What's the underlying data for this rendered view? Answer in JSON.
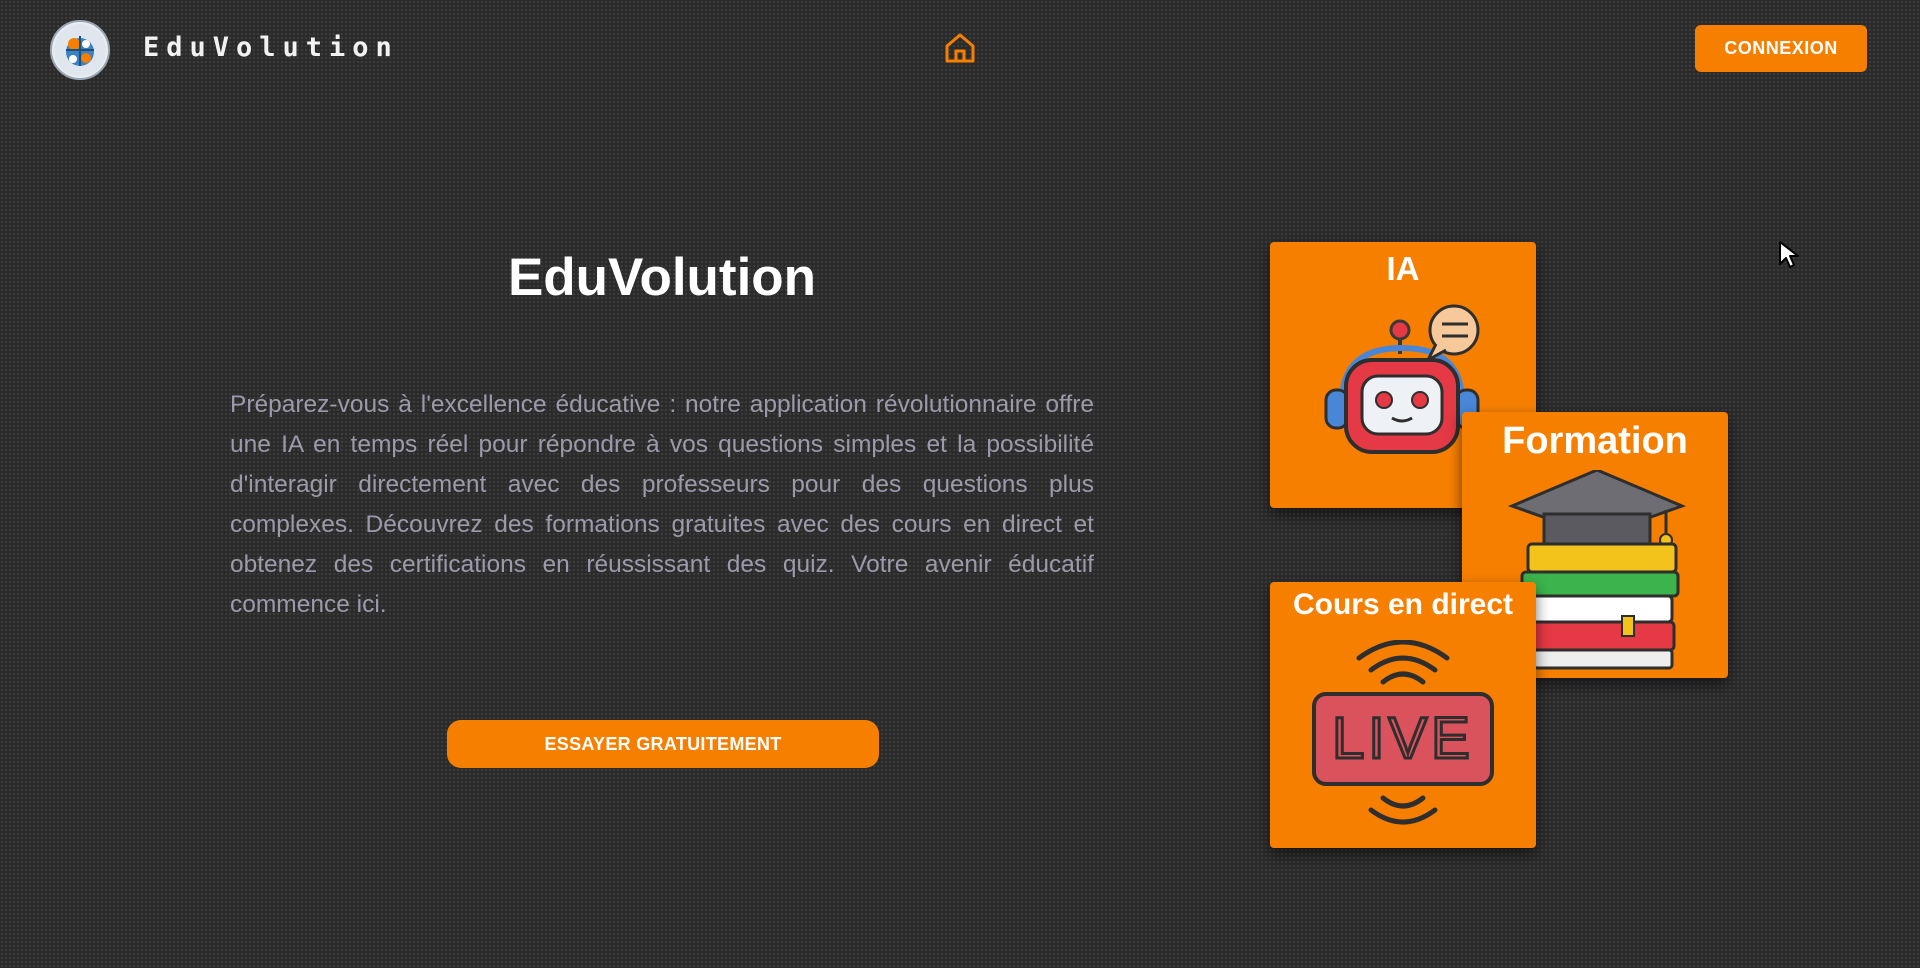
{
  "header": {
    "brand_name": "EduVolution",
    "logo_icon": "eduvolution-logo",
    "home_icon": "home-icon",
    "connexion_label": "CONNEXION"
  },
  "hero": {
    "title": "EduVolution",
    "description": "Préparez-vous à l'excellence éducative : notre application révolutionnaire offre une IA en temps réel pour répondre à vos questions simples et la possibilité d'interagir directement avec des professeurs pour des questions plus complexes. Découvrez des formations gratuites avec des cours en direct et obtenez des certifications en réussissant des quiz. Votre avenir éducatif commence ici.",
    "cta_label": "ESSAYER GRATUITEMENT"
  },
  "cards": [
    {
      "title": "IA",
      "icon": "robot-chat-icon"
    },
    {
      "title": "Formation",
      "icon": "graduation-books-icon"
    },
    {
      "title": "Cours en direct",
      "icon": "live-broadcast-icon",
      "badge_text": "LIVE"
    }
  ],
  "colors": {
    "accent": "#f77f00",
    "background": "#2b2b2b",
    "text_muted": "#9c9aaa"
  }
}
